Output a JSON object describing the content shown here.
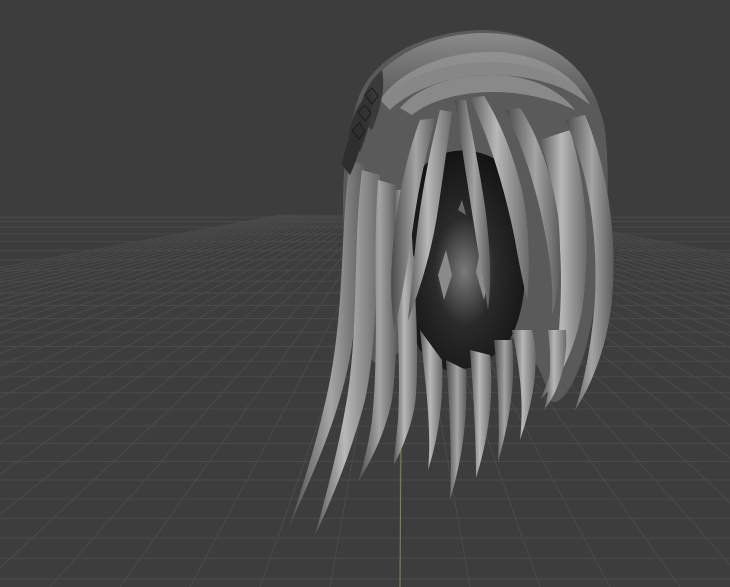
{
  "viewport": {
    "background_color": "#3d3d3d",
    "grid_color": "#4a4a4a",
    "y_axis_color": "#7d8a4a",
    "object": "hair-mesh",
    "shading": "solid grey clay"
  }
}
